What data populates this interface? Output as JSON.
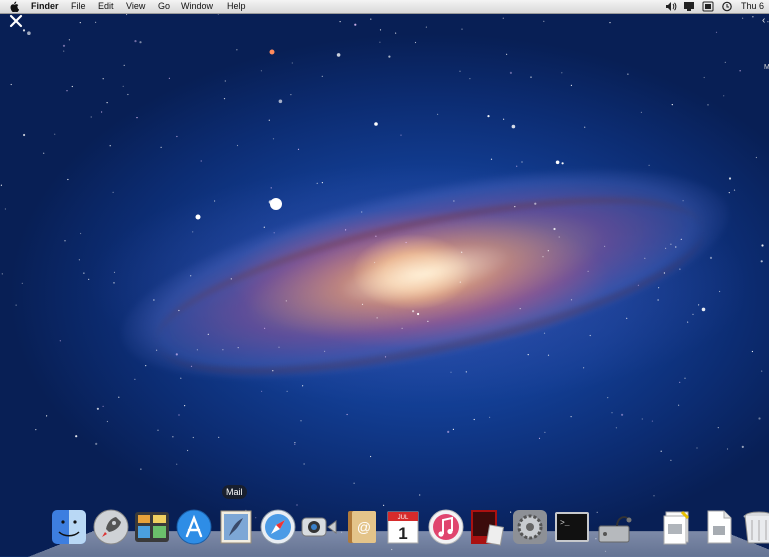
{
  "menubar": {
    "app_name": "Finder",
    "menus": [
      "File",
      "Edit",
      "View",
      "Go",
      "Window",
      "Help"
    ],
    "clock": "Thu 6",
    "status_icons": [
      "volume-icon",
      "display-icon",
      "battery-icon",
      "time-machine-icon"
    ]
  },
  "wallpaper": {
    "description_icon": "andromeda-galaxy-wallpaper"
  },
  "edge_text": "M",
  "dock": {
    "tooltip": "Mail",
    "items": [
      {
        "icon": "finder-icon"
      },
      {
        "icon": "launchpad-icon"
      },
      {
        "icon": "mission-control-icon"
      },
      {
        "icon": "app-store-icon"
      },
      {
        "icon": "mail-icon"
      },
      {
        "icon": "safari-icon"
      },
      {
        "icon": "facetime-icon"
      },
      {
        "icon": "address-book-icon"
      },
      {
        "icon": "calendar-icon",
        "month": "JUL",
        "day": "1"
      },
      {
        "icon": "itunes-icon"
      },
      {
        "icon": "photo-booth-icon"
      },
      {
        "icon": "system-preferences-icon"
      },
      {
        "icon": "terminal-icon",
        "prompt": ">_"
      },
      {
        "icon": "disk-utility-icon"
      },
      {
        "icon": "stack-icon"
      },
      {
        "icon": "document-icon"
      },
      {
        "icon": "trash-icon"
      }
    ]
  },
  "colors": {
    "menubar": "#e6e6e6",
    "space_blue": "#123d92",
    "tooltip_bg": "#1e1e1e"
  }
}
